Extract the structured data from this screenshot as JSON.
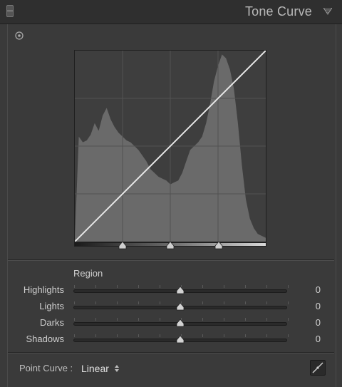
{
  "header": {
    "title": "Tone Curve",
    "menu_icon": "panel-menu-triangle-icon"
  },
  "graph": {
    "histogram_profile": [
      0.01,
      0.55,
      0.52,
      0.53,
      0.56,
      0.62,
      0.58,
      0.66,
      0.7,
      0.64,
      0.6,
      0.57,
      0.55,
      0.53,
      0.52,
      0.5,
      0.48,
      0.45,
      0.42,
      0.38,
      0.36,
      0.34,
      0.33,
      0.32,
      0.3,
      0.31,
      0.32,
      0.36,
      0.42,
      0.48,
      0.5,
      0.52,
      0.55,
      0.62,
      0.72,
      0.84,
      0.92,
      0.98,
      0.96,
      0.9,
      0.8,
      0.62,
      0.4,
      0.22,
      0.12,
      0.07,
      0.04,
      0.03,
      0.02
    ],
    "curve_points": [
      [
        0,
        0
      ],
      [
        1,
        1
      ]
    ]
  },
  "region": {
    "label": "Region",
    "sliders": [
      {
        "name": "Highlights",
        "value": "0",
        "level": 0.5
      },
      {
        "name": "Lights",
        "value": "0",
        "level": 0.5
      },
      {
        "name": "Darks",
        "value": "0",
        "level": 0.5
      },
      {
        "name": "Shadows",
        "value": "0",
        "level": 0.5
      }
    ]
  },
  "split_points": [
    0.25,
    0.5,
    0.75
  ],
  "footer": {
    "point_curve_label": "Point Curve :",
    "point_curve_value": "Linear"
  }
}
